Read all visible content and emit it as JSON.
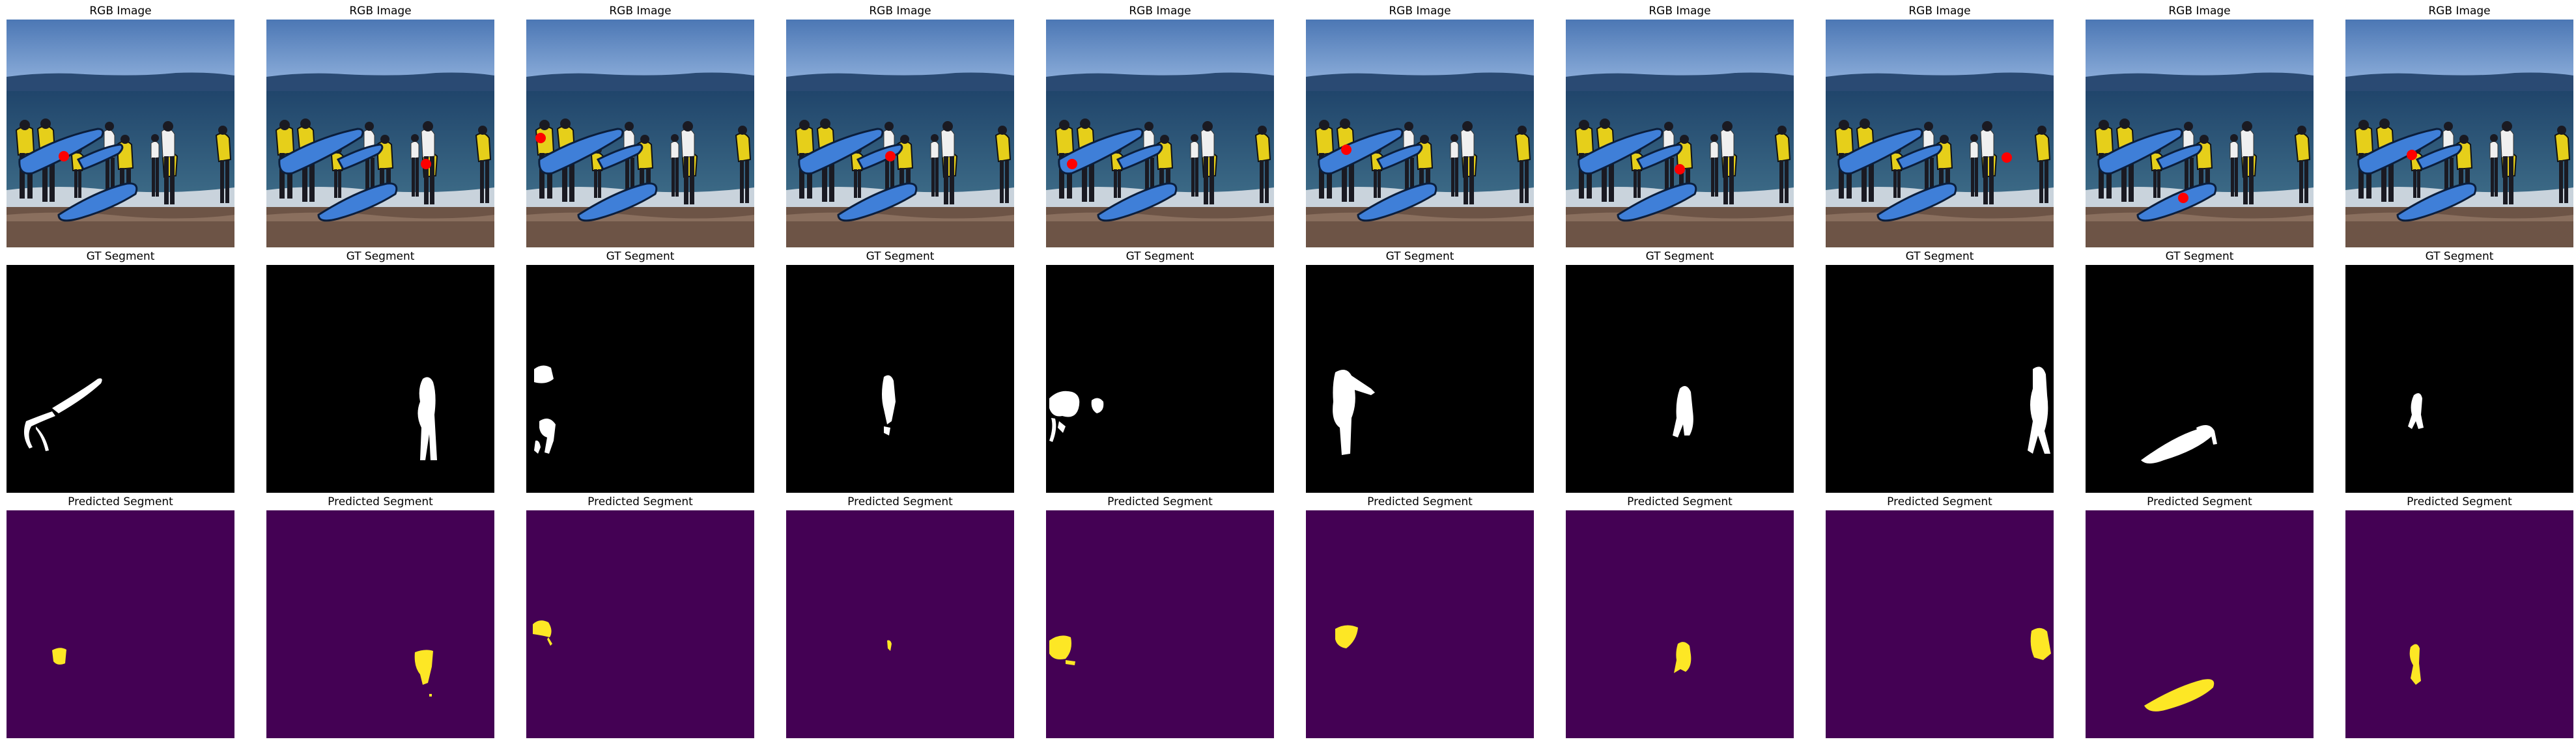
{
  "row_titles": {
    "rgb": "RGB Image",
    "gt": "GT Segment",
    "pred": "Predicted Segment"
  },
  "colors": {
    "mask_background": "#000000",
    "mask_foreground": "#ffffff",
    "pred_background": "#440154",
    "pred_foreground": "#fde725",
    "point_marker": "#ff0000"
  },
  "columns": [
    {
      "point": "person-left board",
      "gt_mask": "surfboard-left",
      "pred_mask": "small-blob-left"
    },
    {
      "point": "person-right white shirt",
      "gt_mask": "person-standing-right",
      "pred_mask": "torso-right"
    },
    {
      "point": "person-far-left",
      "gt_mask": "person-far-left",
      "pred_mask": "head-left"
    },
    {
      "point": "person-center",
      "gt_mask": "person-center",
      "pred_mask": "tiny-center"
    },
    {
      "point": "person-left yellow",
      "gt_mask": "people-left-cluster",
      "pred_mask": "blob-left-low"
    },
    {
      "point": "person-left back",
      "gt_mask": "person-with-board",
      "pred_mask": "blob-left-mid"
    },
    {
      "point": "person-child",
      "gt_mask": "child-center",
      "pred_mask": "child-center"
    },
    {
      "point": "person-right edge",
      "gt_mask": "person-right-edge",
      "pred_mask": "right-edge-blob"
    },
    {
      "point": "surfboard-bottom",
      "gt_mask": "surfboard-bottom",
      "pred_mask": "surfboard-bottom"
    },
    {
      "point": "person-small",
      "gt_mask": "small-figure",
      "pred_mask": "small-figure"
    }
  ]
}
